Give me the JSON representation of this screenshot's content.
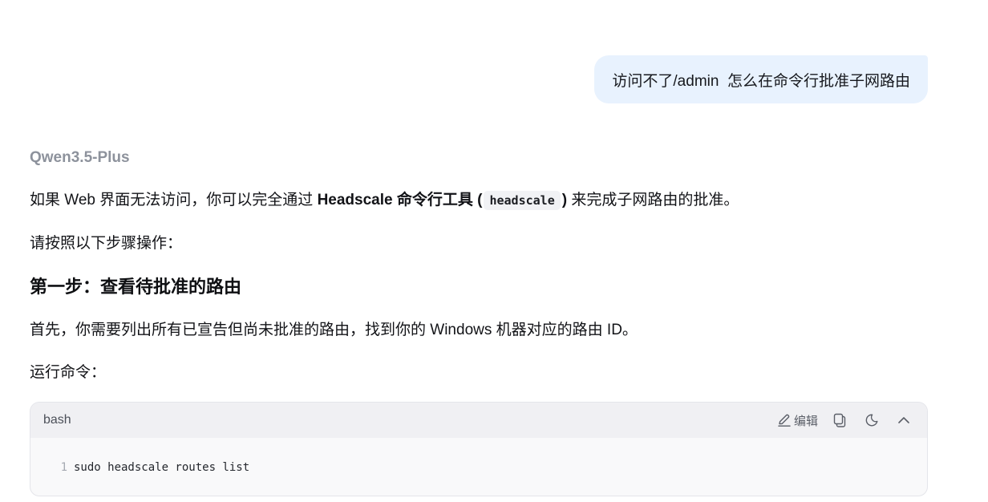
{
  "user_message": {
    "text": "访问不了/admin  怎么在命令行批准子网路由"
  },
  "assistant": {
    "model_name": "Qwen3.5-Plus",
    "intro": {
      "prefix": "如果 Web 界面无法访问，你可以完全通过 ",
      "bold_text": "Headscale 命令行工具 (",
      "inline_code": "headscale",
      "bold_close": ")",
      "suffix": " 来完成子网路由的批准。"
    },
    "instruction": "请按照以下步骤操作：",
    "step1_heading": "第一步：查看待批准的路由",
    "step1_desc": "首先，你需要列出所有已宣告但尚未批准的路由，找到你的 Windows 机器对应的路由 ID。",
    "run_command_label": "运行命令："
  },
  "code_block": {
    "language": "bash",
    "edit_label": "编辑",
    "icons": [
      "edit-icon",
      "copy-icon",
      "theme-moon-icon",
      "collapse-chevron-up-icon"
    ],
    "lines": [
      {
        "number": "1",
        "code": "sudo headscale routes list"
      }
    ]
  }
}
